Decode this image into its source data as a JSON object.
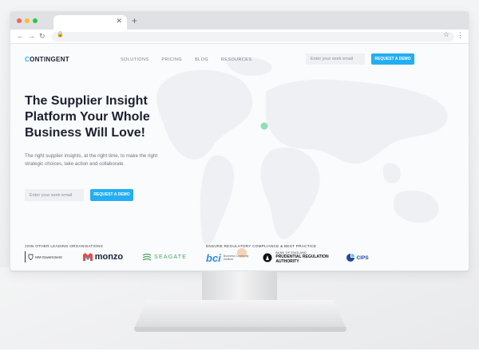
{
  "site": {
    "logo": "CONTINGENT",
    "nav": [
      "SOLUTIONS",
      "PRICING",
      "BLOG",
      "RESOURCES"
    ],
    "header_email_placeholder": "Enter your work email",
    "header_cta": "REQUEST A DEMO"
  },
  "hero": {
    "title_lines": [
      "The Supplier Insight",
      "Platform Your Whole",
      "Business Will Love!"
    ],
    "subtitle_lines": [
      "The right supplier insights, at the right time, to make the right",
      "strategic choices, take action and collaborate."
    ],
    "email_placeholder": "Enter your work email",
    "cta": "REQUEST A DEMO"
  },
  "organisations": {
    "label": "JOIN OTHER LEADING ORGANISATIONS",
    "hm_government": "HM Government",
    "monzo": "monzo",
    "seagate": "SEAGATE"
  },
  "compliance": {
    "label": "ENSURE REGULATORY COMPLIANCE & BEST PRACTICE",
    "bci_line1": "Business Continuity",
    "bci_line2": "Institute",
    "boe_small": "BANK OF ENGLAND",
    "boe_line1": "PRUDENTIAL REGULATION",
    "boe_line2": "AUTHORITY",
    "cips": "CIPS"
  },
  "colors": {
    "accent": "#23aef2",
    "dark_text": "#1b2030",
    "map_land": "#eef0f3",
    "marker_green": "#8fe0b5",
    "marker_orange": "#f5c9a6",
    "dot_red": "#ff5f57",
    "dot_yellow": "#febc2e",
    "dot_green": "#28c840"
  }
}
